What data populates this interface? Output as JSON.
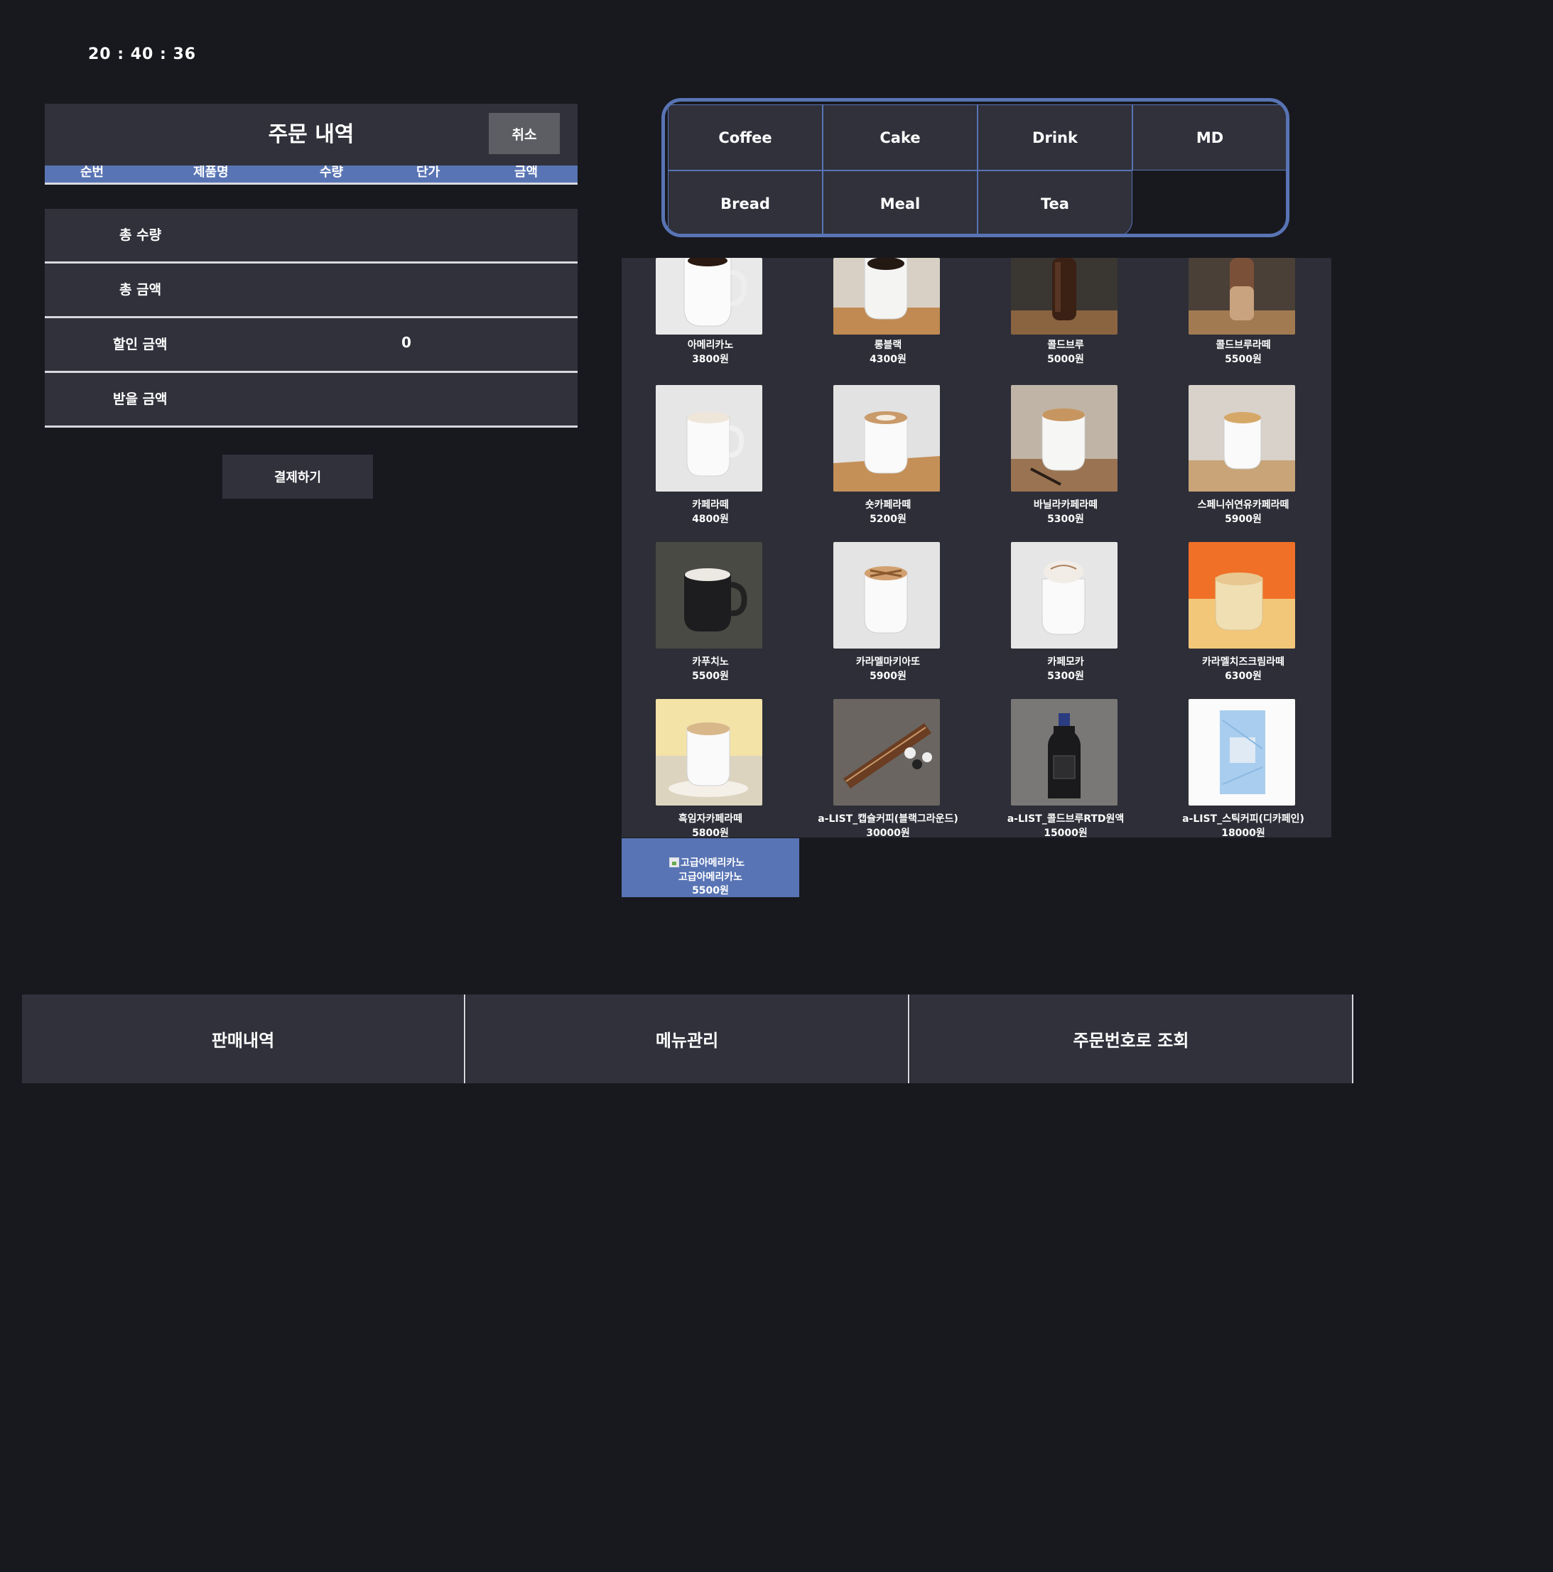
{
  "clock": "20 : 40 : 36",
  "order": {
    "title": "주문 내역",
    "cancel_label": "취소",
    "columns": [
      "순번",
      "제품명",
      "수량",
      "단가",
      "금액"
    ],
    "summary": [
      {
        "label": "총 수량",
        "value": ""
      },
      {
        "label": "총 금액",
        "value": ""
      },
      {
        "label": "할인 금액",
        "value": "0"
      },
      {
        "label": "받을 금액",
        "value": ""
      }
    ],
    "pay_label": "결제하기"
  },
  "categories": [
    "Coffee",
    "Cake",
    "Drink",
    "MD",
    "Bread",
    "Meal",
    "Tea"
  ],
  "menu": [
    {
      "name": "아메리카노",
      "price": "3800원",
      "icon": "black-coffee-mug"
    },
    {
      "name": "롱블랙",
      "price": "4300원",
      "icon": "black-coffee-mug-on-tray"
    },
    {
      "name": "콜드브루",
      "price": "5000원",
      "icon": "iced-coffee-glass"
    },
    {
      "name": "콜드브루라떼",
      "price": "5500원",
      "icon": "iced-latte-glass"
    },
    {
      "name": "카페라떼",
      "price": "4800원",
      "icon": "latte-mug"
    },
    {
      "name": "숏카페라떼",
      "price": "5200원",
      "icon": "latte-mug-on-tray"
    },
    {
      "name": "바닐라카페라떼",
      "price": "5300원",
      "icon": "vanilla-latte-mug"
    },
    {
      "name": "스페니쉬연유카페라떼",
      "price": "5900원",
      "icon": "spanish-latte-mug"
    },
    {
      "name": "카푸치노",
      "price": "5500원",
      "icon": "cappuccino-dark-mug"
    },
    {
      "name": "카라멜마키아또",
      "price": "5900원",
      "icon": "caramel-macchiato-mug"
    },
    {
      "name": "카페모카",
      "price": "5300원",
      "icon": "cafe-mocha-mug"
    },
    {
      "name": "카라멜치즈크림라떼",
      "price": "6300원",
      "icon": "caramel-cheese-latte-mug"
    },
    {
      "name": "흑임자카페라떼",
      "price": "5800원",
      "icon": "black-sesame-latte-mug"
    },
    {
      "name": "a-LIST_캡슐커피(블랙그라운드)",
      "price": "30000원",
      "icon": "capsule-coffee-pack"
    },
    {
      "name": "a-LIST_콜드브루RTD원액",
      "price": "15000원",
      "icon": "cold-brew-bottle"
    },
    {
      "name": "a-LIST_스틱커피(디카페인)",
      "price": "18000원",
      "icon": "stick-coffee-box"
    }
  ],
  "extra_item": {
    "alt": "고급아메리카노",
    "name": "고급아메리카노",
    "price": "5500원"
  },
  "nav": [
    "판매내역",
    "메뉴관리",
    "주문번호로 조회"
  ],
  "colors": {
    "background": "#18191e",
    "panel": "#30313b",
    "accent": "#5874b4",
    "menu_bg": "#2d2e37"
  }
}
